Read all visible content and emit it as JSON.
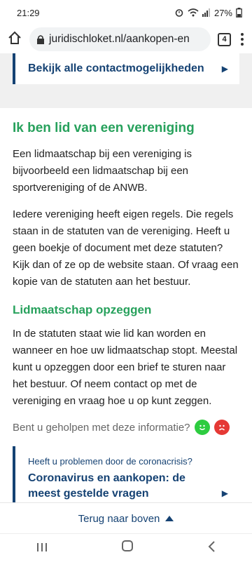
{
  "status": {
    "time": "21:29",
    "battery": "27%"
  },
  "browser": {
    "url": "juridischloket.nl/aankopen-en",
    "tabs": "4"
  },
  "contact": {
    "link": "Bekijk alle contactmogelijkheden"
  },
  "section": {
    "title": "Ik ben lid van een vereniging",
    "p1": "Een lidmaatschap bij een vereniging is bijvoorbeeld een lidmaatschap bij een sportvereniging of de ANWB.",
    "p2": "Iedere vereniging heeft eigen regels. Die regels staan in de statuten van de vereniging. Heeft u geen boekje of document met deze statuten? Kijk dan of ze op de website staan. Of vraag een kopie van de statuten aan het bestuur.",
    "subtitle": "Lidmaatschap opzeggen",
    "p3": "In de statuten staat wie lid kan worden en wanneer en hoe uw lidmaatschap stopt. Meestal kunt u opzeggen door een brief te sturen naar het bestuur. Of neem contact op met de vereniging en vraag hoe u op kunt zeggen."
  },
  "feedback": {
    "question": "Bent u geholpen met deze informatie?"
  },
  "corona": {
    "label": "Heeft u problemen door de coronacrisis?",
    "link": "Coronavirus en aankopen: de meest gestelde vragen"
  },
  "backtop": {
    "label": "Terug naar boven"
  },
  "icons": {
    "home": "home-icon",
    "lock": "lock-icon",
    "menu": "kebab-menu-icon",
    "chevron": "chevron-right-icon",
    "happy": "happy-face-icon",
    "sad": "sad-face-icon",
    "up": "arrow-up-icon"
  },
  "colors": {
    "brand_blue": "#154273",
    "accent_green": "#27a15c"
  }
}
